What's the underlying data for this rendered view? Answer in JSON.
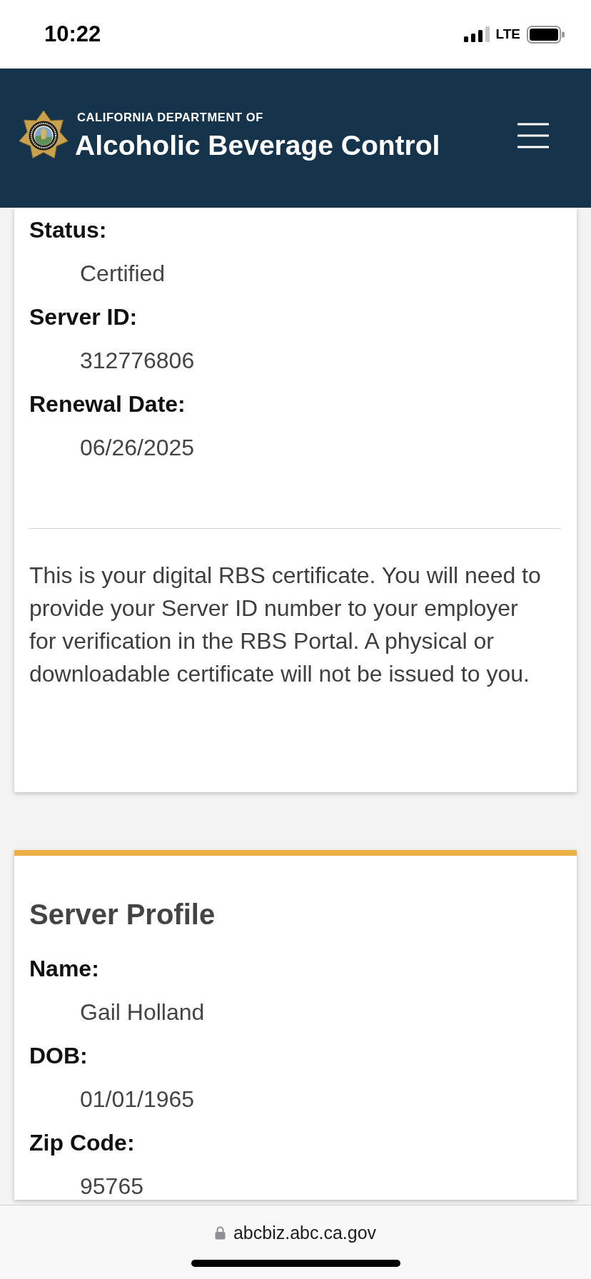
{
  "status_bar": {
    "time": "10:22",
    "network": "LTE"
  },
  "header": {
    "agency_line": "CALIFORNIA DEPARTMENT OF",
    "title": "Alcoholic Beverage Control"
  },
  "certificate_card": {
    "fields": [
      {
        "label": "Status:",
        "value": "Certified"
      },
      {
        "label": "Server ID:",
        "value": "312776806"
      },
      {
        "label": "Renewal Date:",
        "value": "06/26/2025"
      }
    ],
    "notice": "This is your digital RBS certificate. You will need to provide your Server ID number to your employer for verification in the RBS Portal. A physical or downloadable certificate will not be issued to you."
  },
  "profile_card": {
    "title": "Server Profile",
    "fields": [
      {
        "label": "Name:",
        "value": "Gail Holland"
      },
      {
        "label": "DOB:",
        "value": "01/01/1965"
      },
      {
        "label": "Zip Code:",
        "value": "95765"
      }
    ]
  },
  "browser_bar": {
    "url": "abcbiz.abc.ca.gov"
  }
}
